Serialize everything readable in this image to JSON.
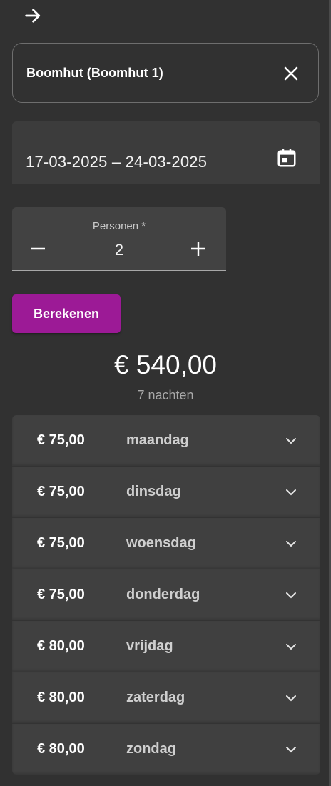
{
  "header": {
    "back_icon": "arrow-right-icon"
  },
  "accommodation": {
    "title": "Boomhut (Boomhut 1)",
    "close_icon": "close-icon"
  },
  "dates": {
    "value": "17-03-2025 – 24-03-2025",
    "calendar_icon": "calendar-icon"
  },
  "persons": {
    "label": "Personen *",
    "count": "2",
    "minus_icon": "minus-icon",
    "plus_icon": "plus-icon"
  },
  "calculate": {
    "label": "Berekenen"
  },
  "summary": {
    "total": "€ 540,00",
    "nights": "7 nachten"
  },
  "days": [
    {
      "price": "€ 75,00",
      "day": "maandag"
    },
    {
      "price": "€ 75,00",
      "day": "dinsdag"
    },
    {
      "price": "€ 75,00",
      "day": "woensdag"
    },
    {
      "price": "€ 75,00",
      "day": "donderdag"
    },
    {
      "price": "€ 80,00",
      "day": "vrijdag"
    },
    {
      "price": "€ 80,00",
      "day": "zaterdag"
    },
    {
      "price": "€ 80,00",
      "day": "zondag"
    }
  ],
  "colors": {
    "background": "#313131",
    "accent": "#9c1a96",
    "card": "#404040"
  }
}
